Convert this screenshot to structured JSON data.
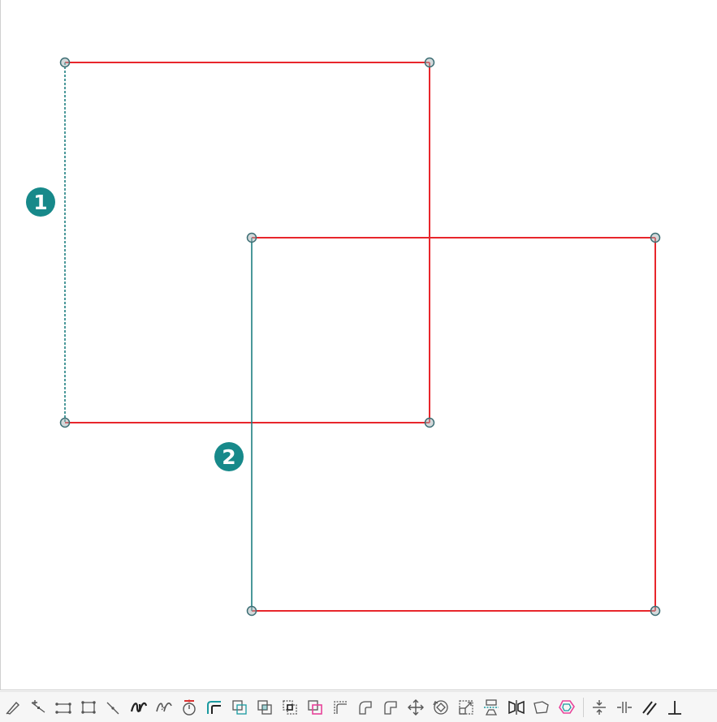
{
  "colors": {
    "edge": "#e8262b",
    "selected_edge": "#1d7f80",
    "vertex_fill": "#a8b4b8",
    "vertex_stroke": "#3c6e74",
    "marker": "#17898a",
    "icon_gray": "#555555",
    "icon_teal": "#1a9aa0",
    "icon_pink": "#e8439a",
    "icon_red": "#d9302f"
  },
  "markers": [
    {
      "label": "1"
    },
    {
      "label": "2"
    }
  ],
  "toolbar": {
    "tools": [
      {
        "name": "edit-nodes-tool-icon"
      },
      {
        "name": "add-node-tool-icon"
      },
      {
        "name": "line-tool-icon"
      },
      {
        "name": "polyline-tool-icon"
      },
      {
        "name": "segment-tool-icon"
      },
      {
        "name": "bezier-tool-icon"
      },
      {
        "name": "spline-tool-icon"
      },
      {
        "name": "circle-center-tool-icon"
      },
      {
        "name": "offset-tool-icon"
      },
      {
        "name": "boolean-union-icon"
      },
      {
        "name": "boolean-difference-icon"
      },
      {
        "name": "boolean-intersection-icon"
      },
      {
        "name": "boolean-xor-icon"
      },
      {
        "name": "corner-fillet-icon"
      },
      {
        "name": "round-corner-icon"
      },
      {
        "name": "chamfer-corner-icon"
      },
      {
        "name": "move-tool-icon"
      },
      {
        "name": "rotate-tool-icon"
      },
      {
        "name": "scale-tool-icon"
      },
      {
        "name": "align-tool-icon"
      },
      {
        "name": "mirror-tool-icon"
      },
      {
        "name": "skew-tool-icon"
      },
      {
        "name": "simplify-shape-icon"
      },
      {
        "name": "distribute-vertical-icon"
      },
      {
        "name": "distribute-horizontal-icon"
      },
      {
        "name": "parallel-constraint-icon"
      },
      {
        "name": "perpendicular-constraint-icon"
      }
    ]
  }
}
